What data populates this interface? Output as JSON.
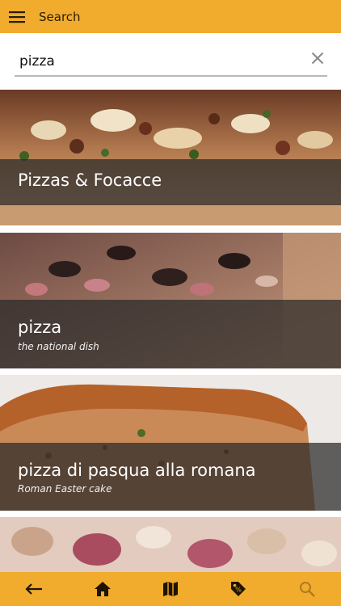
{
  "header": {
    "title": "Search",
    "menu_icon": "menu-icon",
    "background_color": "#f1ac2d"
  },
  "search": {
    "value": "pizza",
    "clear_icon": "close-icon"
  },
  "results": [
    {
      "title": "Pizzas & Focacce",
      "subtitle": "",
      "image": "pizza-photo"
    },
    {
      "title": "pizza",
      "subtitle": "the national dish",
      "image": "pizza-photo"
    },
    {
      "title": "pizza di pasqua alla romana",
      "subtitle": "Roman Easter cake",
      "image": "cake-photo"
    },
    {
      "title": "",
      "subtitle": "",
      "image": "pasta-bake-photo"
    }
  ],
  "bottom_nav": {
    "items": [
      {
        "icon": "back-arrow-icon",
        "active": false
      },
      {
        "icon": "home-icon",
        "active": false
      },
      {
        "icon": "map-icon",
        "active": false
      },
      {
        "icon": "tag-icon",
        "active": false
      },
      {
        "icon": "search-icon",
        "active": true
      }
    ]
  }
}
